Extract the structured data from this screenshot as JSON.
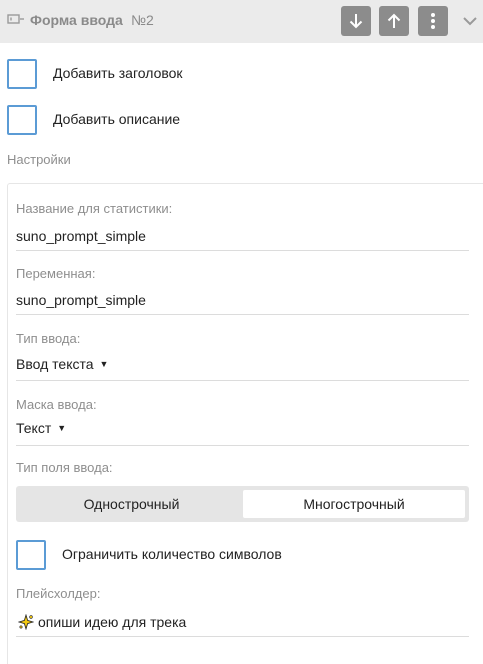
{
  "header": {
    "title": "Форма ввода",
    "number": "№2",
    "icons": [
      "input-form-icon",
      "arrow-down-icon",
      "arrow-up-icon",
      "more-vertical-icon",
      "chevron-down-icon"
    ]
  },
  "options": {
    "add_title": "Добавить заголовок",
    "add_description": "Добавить описание"
  },
  "settings": {
    "section_label": "Настройки",
    "stat_name": {
      "label": "Название для статистики:",
      "value": "suno_prompt_simple"
    },
    "variable": {
      "label": "Переменная:",
      "value": "suno_prompt_simple"
    },
    "input_type": {
      "label": "Тип ввода:",
      "value": "Ввод текста"
    },
    "input_mask": {
      "label": "Маска ввода:",
      "value": "Текст"
    },
    "field_type": {
      "label": "Тип поля ввода:",
      "options": [
        "Однострочный",
        "Многострочный"
      ],
      "selected": "Многострочный"
    },
    "limit_chars": "Ограничить количество символов",
    "placeholder": {
      "label": "Плейсхолдер:",
      "value": "опиши идею для трека",
      "emoji": "sparkle-icon"
    }
  },
  "colors": {
    "header_bg": "#ebebeb",
    "button_bg": "#8c8c8c",
    "checkbox_border": "#5b9bd5",
    "muted_text": "#8e8e8e"
  }
}
